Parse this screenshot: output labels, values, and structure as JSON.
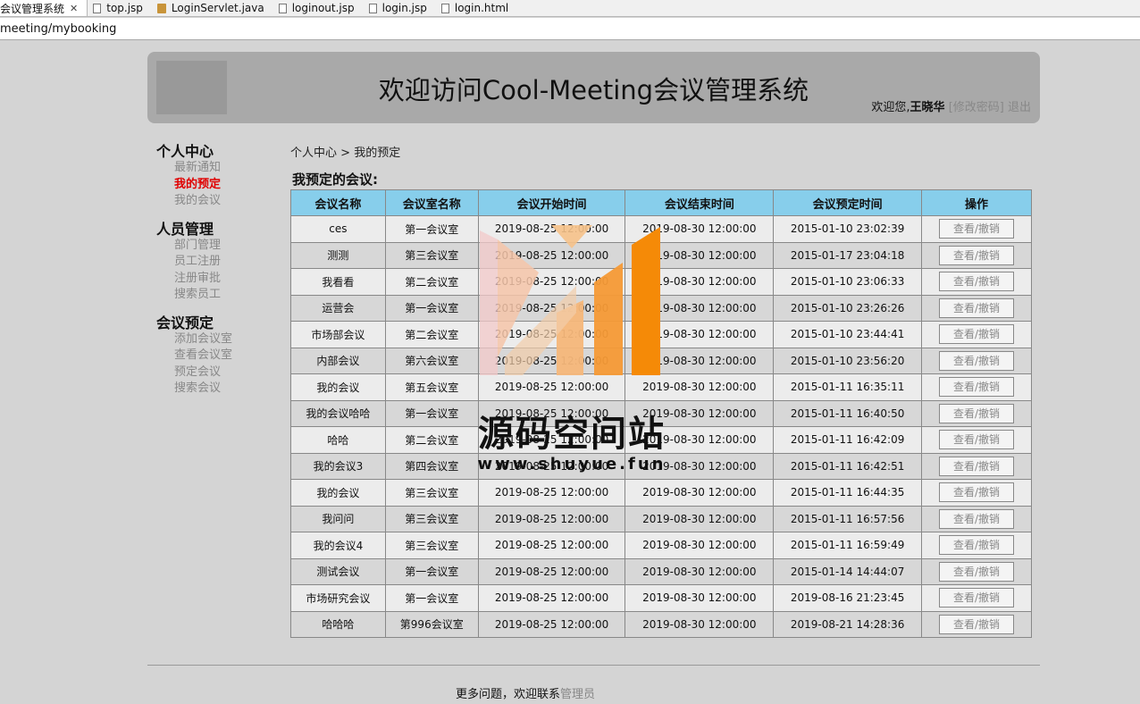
{
  "ide_tabs": [
    {
      "label": "会议管理系统",
      "icon": "page-icon",
      "active": true
    },
    {
      "label": "top.jsp",
      "icon": "file-icon"
    },
    {
      "label": "LoginServlet.java",
      "icon": "java-file-icon"
    },
    {
      "label": "loginout.jsp",
      "icon": "file-icon"
    },
    {
      "label": "login.jsp",
      "icon": "file-icon"
    },
    {
      "label": "login.html",
      "icon": "file-icon"
    }
  ],
  "tab_close_glyph": "✕",
  "address": "meeting/mybooking",
  "header": {
    "title": "欢迎访问Cool-Meeting会议管理系统",
    "welcome_prefix": "欢迎您,",
    "user_name": "王晓华",
    "change_password": "[修改密码]",
    "logout": "退出"
  },
  "nav": [
    {
      "title": "个人中心",
      "items": [
        {
          "label": "最新通知"
        },
        {
          "label": "我的预定",
          "active": true
        },
        {
          "label": "我的会议"
        }
      ]
    },
    {
      "title": "人员管理",
      "items": [
        {
          "label": "部门管理"
        },
        {
          "label": "员工注册"
        },
        {
          "label": "注册审批"
        },
        {
          "label": "搜索员工"
        }
      ]
    },
    {
      "title": "会议预定",
      "items": [
        {
          "label": "添加会议室"
        },
        {
          "label": "查看会议室"
        },
        {
          "label": "预定会议"
        },
        {
          "label": "搜索会议"
        }
      ]
    }
  ],
  "breadcrumb": {
    "root": "个人中心",
    "sep": ">",
    "current": "我的预定"
  },
  "section_title": "我预定的会议:",
  "table": {
    "columns": [
      "会议名称",
      "会议室名称",
      "会议开始时间",
      "会议结束时间",
      "会议预定时间",
      "操作"
    ],
    "action_label": "查看/撤销",
    "rows": [
      [
        "ces",
        "第一会议室",
        "2019-08-25 12:00:00",
        "2019-08-30 12:00:00",
        "2015-01-10 23:02:39"
      ],
      [
        "测测",
        "第三会议室",
        "2019-08-25 12:00:00",
        "2019-08-30 12:00:00",
        "2015-01-17 23:04:18"
      ],
      [
        "我看看",
        "第二会议室",
        "2019-08-25 12:00:00",
        "2019-08-30 12:00:00",
        "2015-01-10 23:06:33"
      ],
      [
        "运营会",
        "第一会议室",
        "2019-08-25 12:00:00",
        "2019-08-30 12:00:00",
        "2015-01-10 23:26:26"
      ],
      [
        "市场部会议",
        "第二会议室",
        "2019-08-25 12:00:00",
        "2019-08-30 12:00:00",
        "2015-01-10 23:44:41"
      ],
      [
        "内部会议",
        "第六会议室",
        "2019-08-25 12:00:00",
        "2019-08-30 12:00:00",
        "2015-01-10 23:56:20"
      ],
      [
        "我的会议",
        "第五会议室",
        "2019-08-25 12:00:00",
        "2019-08-30 12:00:00",
        "2015-01-11 16:35:11"
      ],
      [
        "我的会议哈哈",
        "第一会议室",
        "2019-08-25 12:00:00",
        "2019-08-30 12:00:00",
        "2015-01-11 16:40:50"
      ],
      [
        "哈哈",
        "第二会议室",
        "2019-08-25 12:00:00",
        "2019-08-30 12:00:00",
        "2015-01-11 16:42:09"
      ],
      [
        "我的会议3",
        "第四会议室",
        "2019-08-25 12:00:00",
        "2019-08-30 12:00:00",
        "2015-01-11 16:42:51"
      ],
      [
        "我的会议",
        "第三会议室",
        "2019-08-25 12:00:00",
        "2019-08-30 12:00:00",
        "2015-01-11 16:44:35"
      ],
      [
        "我问问",
        "第三会议室",
        "2019-08-25 12:00:00",
        "2019-08-30 12:00:00",
        "2015-01-11 16:57:56"
      ],
      [
        "我的会议4",
        "第三会议室",
        "2019-08-25 12:00:00",
        "2019-08-30 12:00:00",
        "2015-01-11 16:59:49"
      ],
      [
        "测试会议",
        "第一会议室",
        "2019-08-25 12:00:00",
        "2019-08-30 12:00:00",
        "2015-01-14 14:44:07"
      ],
      [
        "市场研究会议",
        "第一会议室",
        "2019-08-25 12:00:00",
        "2019-08-30 12:00:00",
        "2019-08-16 21:23:45"
      ],
      [
        "哈哈哈",
        "第996会议室",
        "2019-08-25 12:00:00",
        "2019-08-30 12:00:00",
        "2019-08-21 14:28:36"
      ]
    ]
  },
  "footer": {
    "text": "更多问题，欢迎联系",
    "link": "管理员"
  },
  "watermark": {
    "text": "源码空间站",
    "url": "www.shuyue.fun"
  },
  "colors": {
    "table_header": "#87ceeb",
    "active_nav": "#e00000",
    "header_bg": "#a9a9a9",
    "watermark_orange": "#f58a07"
  }
}
